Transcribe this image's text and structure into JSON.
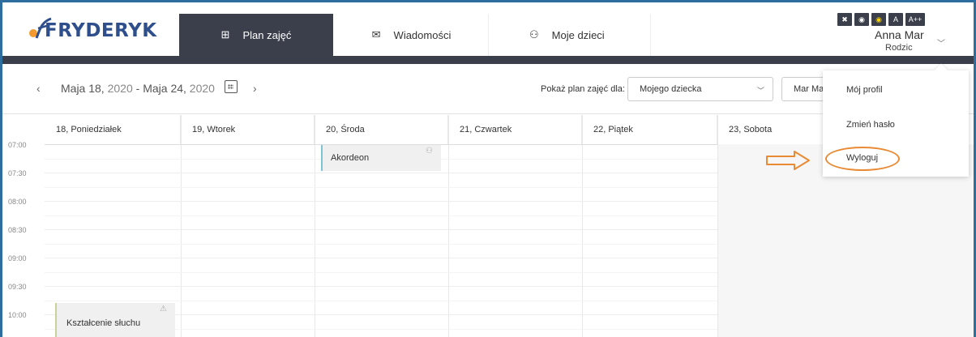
{
  "header": {
    "logo": "FRYDERYK",
    "nav": [
      {
        "label": "Plan zajęć",
        "icon": "grid-icon"
      },
      {
        "label": "Wiadomości",
        "icon": "envelope-icon"
      },
      {
        "label": "Moje dzieci",
        "icon": "children-icon"
      }
    ],
    "accessibility": [
      "A",
      "A++"
    ],
    "user": {
      "name": "Anna Mar",
      "role": "Rodzic"
    }
  },
  "toolbar": {
    "range_a": "Maja 18,",
    "range_a_year": "2020",
    "range_sep": " - ",
    "range_b": "Maja 24,",
    "range_b_year": "2020",
    "show_for_label": "Pokaż plan zajęć dla:",
    "select_value": "Mojego dziecka",
    "select2_value": "Mar Ma"
  },
  "calendar": {
    "days": [
      "18, Poniedziałek",
      "19, Wtorek",
      "20, Środa",
      "21, Czwartek",
      "22, Piątek",
      "23, Sobota"
    ],
    "times": [
      "07:00",
      "07:30",
      "08:00",
      "08:30",
      "09:00",
      "09:30",
      "10:00"
    ],
    "events": [
      {
        "title": "Akordeon",
        "day": "20, Środa",
        "start": "07:00"
      },
      {
        "title": "Kształcenie słuchu",
        "day": "18, Poniedziałek",
        "start": "10:00"
      }
    ]
  },
  "dropdown": {
    "items": [
      "Mój profil",
      "Zmień hasło",
      "Wyloguj"
    ]
  },
  "colors": {
    "dark": "#3a3f4b",
    "annotation": "#e98a35",
    "frame": "#2e6e9e"
  }
}
